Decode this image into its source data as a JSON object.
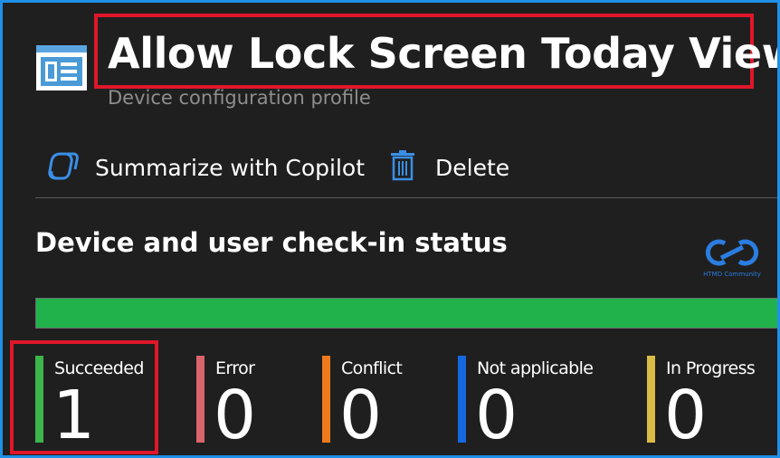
{
  "header": {
    "title": "Allow Lock Screen Today View",
    "subtitle": "Device configuration profile",
    "icon": "profile-icon"
  },
  "toolbar": {
    "copilot_label": "Summarize with Copilot",
    "copilot_icon": "copilot-icon",
    "delete_label": "Delete",
    "delete_icon": "trash-icon"
  },
  "status_section": {
    "title": "Device and user check-in status",
    "progress_succeeded_fraction": 1.0,
    "colors": {
      "succeeded": "#22b24c",
      "bar_background": "#2f2f2f"
    }
  },
  "stats": [
    {
      "label": "Succeeded",
      "value": "1",
      "color": "#3cb54a"
    },
    {
      "label": "Error",
      "value": "0",
      "color": "#d9646b"
    },
    {
      "label": "Conflict",
      "value": "0",
      "color": "#ee7a1e"
    },
    {
      "label": "Not applicable",
      "value": "0",
      "color": "#1568e0"
    },
    {
      "label": "In Progress",
      "value": "0",
      "color": "#d9bb46"
    }
  ],
  "watermark": {
    "text": "HTMD Community",
    "icon": "htmd-logo-icon"
  },
  "colors": {
    "accent": "#1e90e8",
    "highlight": "#e0162b",
    "background": "#1f1f1f"
  }
}
